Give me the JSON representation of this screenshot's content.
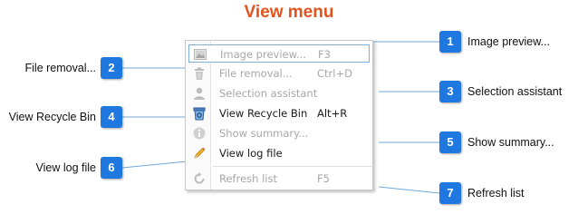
{
  "title": "View menu",
  "colors": {
    "title": "#e1541e",
    "badge": "#1e78e0",
    "connector": "#6fa8d8",
    "menu_text_enabled": "#1a1a1a",
    "menu_text_disabled": "#a7a7a7",
    "hover_border": "#7fb0dc"
  },
  "menu": {
    "items": [
      {
        "label": "Image preview...",
        "shortcut": "F3",
        "icon": "image-preview-icon",
        "enabled": false,
        "highlighted": true
      },
      {
        "label": "File removal...",
        "shortcut": "Ctrl+D",
        "icon": "trash-icon",
        "enabled": false
      },
      {
        "label": "Selection assistant",
        "shortcut": "",
        "icon": "user-icon",
        "enabled": false
      },
      {
        "label": "View Recycle Bin",
        "shortcut": "Alt+R",
        "icon": "recycle-bin-icon",
        "enabled": true
      },
      {
        "label": "Show summary...",
        "shortcut": "",
        "icon": "info-icon",
        "enabled": false
      },
      {
        "label": "View log file",
        "shortcut": "",
        "icon": "pencil-icon",
        "enabled": true
      },
      {
        "label": "Refresh list",
        "shortcut": "F5",
        "icon": "refresh-icon",
        "enabled": false
      }
    ]
  },
  "callouts": [
    {
      "number": "1",
      "text": "Image preview..."
    },
    {
      "number": "2",
      "text": "File removal..."
    },
    {
      "number": "3",
      "text": "Selection assistant"
    },
    {
      "number": "4",
      "text": "View Recycle Bin"
    },
    {
      "number": "5",
      "text": "Show summary..."
    },
    {
      "number": "6",
      "text": "View log file"
    },
    {
      "number": "7",
      "text": "Refresh list"
    }
  ]
}
